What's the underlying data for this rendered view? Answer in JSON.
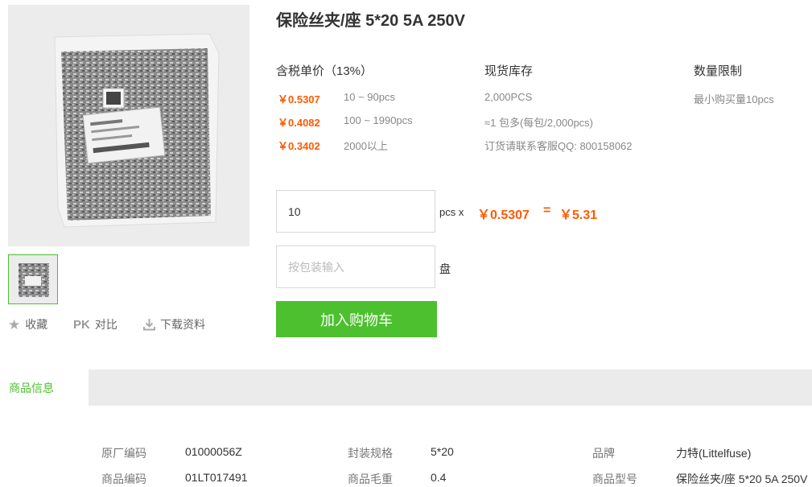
{
  "product": {
    "title": "保险丝夹/座 5*20 5A 250V"
  },
  "actions": {
    "favorite": "收藏",
    "pk_badge": "PK",
    "compare": "对比",
    "download": "下载资料"
  },
  "pricing": {
    "header": "含税单价（13%）",
    "tiers": [
      {
        "price": "￥0.5307",
        "range": "10 ~ 90pcs"
      },
      {
        "price": "￥0.4082",
        "range": "100 ~ 1990pcs"
      },
      {
        "price": "￥0.3402",
        "range": "2000以上"
      }
    ]
  },
  "stock": {
    "header": "现货库存",
    "quantity": "2,000PCS",
    "package": "≈1 包多(每包/2,000pcs)",
    "contact": "订货请联系客服QQ: 800158062"
  },
  "limit": {
    "header": "数量限制",
    "min_order": "最小购买量10pcs"
  },
  "order": {
    "quantity_value": "10",
    "unit_multiply": "pcs x",
    "unit_price": "￥0.5307",
    "equals": "=",
    "total": "￥5.31",
    "pack_placeholder": "按包装输入",
    "pack_unit": "盘",
    "add_to_cart": "加入购物车"
  },
  "tabs": {
    "product_info": "商品信息"
  },
  "specs": {
    "rows": [
      [
        {
          "label": "原厂编码",
          "value": "01000056Z"
        },
        {
          "label": "封装规格",
          "value": "5*20"
        },
        {
          "label": "品牌",
          "value": "力特(Littelfuse)"
        }
      ],
      [
        {
          "label": "商品编码",
          "value": "01LT017491"
        },
        {
          "label": "商品毛重",
          "value": "0.4"
        },
        {
          "label": "商品型号",
          "value": "保险丝夹/座 5*20 5A 250V"
        }
      ]
    ]
  },
  "colors": {
    "accent_green": "#4cc02f",
    "price_orange": "#ff5a00"
  }
}
